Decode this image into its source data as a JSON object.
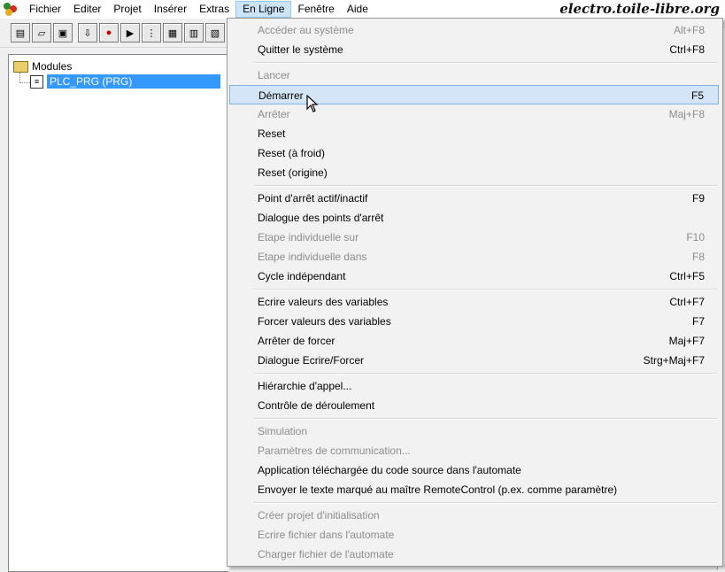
{
  "menubar": {
    "items": [
      {
        "label": "Fichier"
      },
      {
        "label": "Editer"
      },
      {
        "label": "Projet"
      },
      {
        "label": "Insérer"
      },
      {
        "label": "Extras"
      },
      {
        "label": "En Ligne"
      },
      {
        "label": "Fenêtre"
      },
      {
        "label": "Aide"
      }
    ],
    "open_menu": "En Ligne",
    "watermark": "electro.toile-libre.org"
  },
  "toolbar": {
    "icons": [
      "new-file-icon",
      "open-folder-icon",
      "save-icon",
      "login-icon",
      "stop-icon",
      "run-icon",
      "step-icon",
      "tool-a-icon",
      "tool-b-icon",
      "tool-c-icon"
    ]
  },
  "tree": {
    "root_label": "Modules",
    "child_label": "PLC_PRG (PRG)"
  },
  "menu": {
    "items": [
      {
        "label": "Accéder au système",
        "shortcut": "Alt+F8",
        "enabled": false
      },
      {
        "label": "Quitter le système",
        "shortcut": "Ctrl+F8",
        "enabled": true
      },
      {
        "sep": true
      },
      {
        "label": "Lancer",
        "shortcut": "",
        "enabled": false
      },
      {
        "label": "Démarrer",
        "shortcut": "F5",
        "enabled": true,
        "highlighted": true
      },
      {
        "label": "Arrêter",
        "shortcut": "Maj+F8",
        "enabled": false
      },
      {
        "label": "Reset",
        "shortcut": "",
        "enabled": true
      },
      {
        "label": "Reset (à froid)",
        "shortcut": "",
        "enabled": true
      },
      {
        "label": "Reset (origine)",
        "shortcut": "",
        "enabled": true
      },
      {
        "sep": true
      },
      {
        "label": "Point d'arrêt actif/inactif",
        "shortcut": "F9",
        "enabled": true
      },
      {
        "label": "Dialogue des points d'arrêt",
        "shortcut": "",
        "enabled": true
      },
      {
        "label": "Etape individuelle sur",
        "shortcut": "F10",
        "enabled": false
      },
      {
        "label": "Etape individuelle dans",
        "shortcut": "F8",
        "enabled": false
      },
      {
        "label": "Cycle indépendant",
        "shortcut": "Ctrl+F5",
        "enabled": true
      },
      {
        "sep": true
      },
      {
        "label": "Ecrire valeurs des variables",
        "shortcut": "Ctrl+F7",
        "enabled": true
      },
      {
        "label": "Forcer valeurs des variables",
        "shortcut": "F7",
        "enabled": true
      },
      {
        "label": "Arrêter de forcer",
        "shortcut": "Maj+F7",
        "enabled": true
      },
      {
        "label": "Dialogue Ecrire/Forcer",
        "shortcut": "Strg+Maj+F7",
        "enabled": true
      },
      {
        "sep": true
      },
      {
        "label": "Hiérarchie d'appel...",
        "shortcut": "",
        "enabled": true
      },
      {
        "label": "Contrôle de déroulement",
        "shortcut": "",
        "enabled": true
      },
      {
        "sep": true
      },
      {
        "label": "Simulation",
        "shortcut": "",
        "enabled": false
      },
      {
        "label": "Paramètres de communication...",
        "shortcut": "",
        "enabled": false
      },
      {
        "label": "Application téléchargée du code source dans l'automate",
        "shortcut": "",
        "enabled": true
      },
      {
        "label": "Envoyer le texte marqué au maître RemoteControl  (p.ex. comme paramètre)",
        "shortcut": "",
        "enabled": true
      },
      {
        "sep": true
      },
      {
        "label": "Créer projet d'initialisation",
        "shortcut": "",
        "enabled": false
      },
      {
        "label": "Ecrire fichier dans l'automate",
        "shortcut": "",
        "enabled": false
      },
      {
        "label": "Charger fichier de l'automate",
        "shortcut": "",
        "enabled": false
      }
    ]
  },
  "colors": {
    "highlight": "#d4e5f7",
    "selection": "#3399ff",
    "disabled_text": "#8d8d8d"
  }
}
